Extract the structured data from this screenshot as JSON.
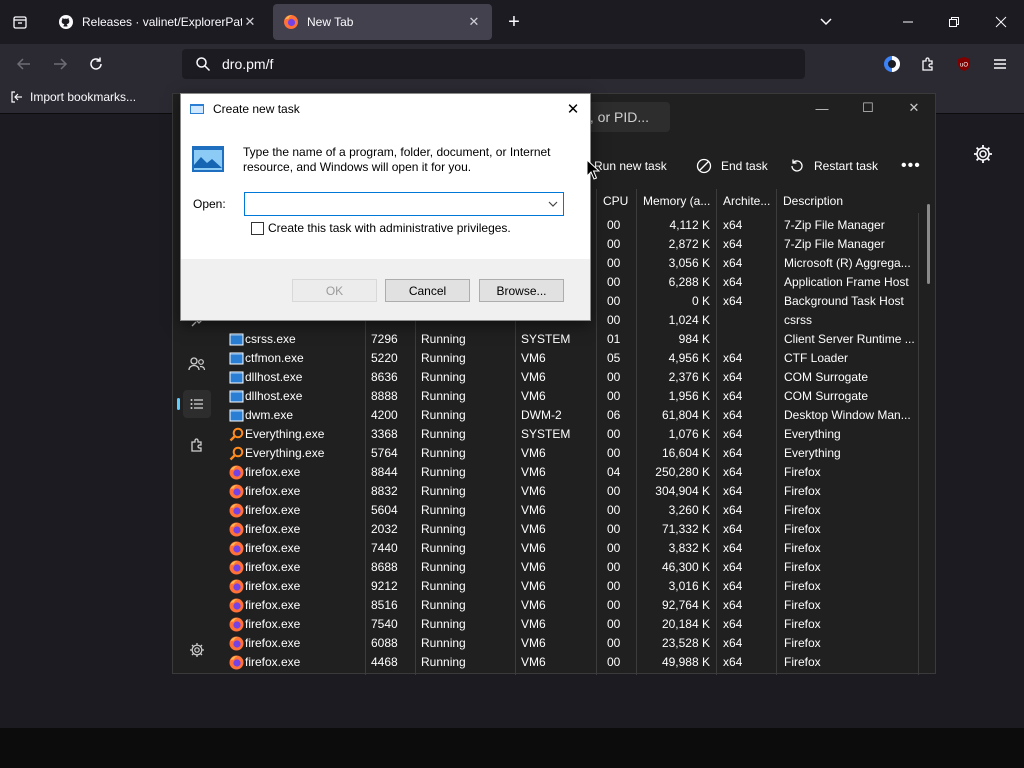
{
  "browser": {
    "tabs": [
      {
        "label": "Releases · valinet/ExplorerPatcher",
        "icon": "github-icon",
        "active": false
      },
      {
        "label": "New Tab",
        "icon": "firefox-icon",
        "active": true
      }
    ],
    "url": "dro.pm/f",
    "bookmark_import": "Import bookmarks..."
  },
  "taskmgr": {
    "search_placeholder": "r, or PID...",
    "toolbar": {
      "run_new_task": "Run new task",
      "end_task": "End task",
      "restart_task": "Restart task"
    },
    "columns": [
      "CPU",
      "Memory (a...",
      "Archite...",
      "Description"
    ],
    "rows": [
      {
        "name": "",
        "pid": "",
        "status": "",
        "user": "",
        "cpu": "00",
        "mem": "4,112 K",
        "arch": "x64",
        "desc": "7-Zip File Manager",
        "icon": ""
      },
      {
        "name": "",
        "pid": "",
        "status": "",
        "user": "",
        "cpu": "00",
        "mem": "2,872 K",
        "arch": "x64",
        "desc": "7-Zip File Manager",
        "icon": ""
      },
      {
        "name": "",
        "pid": "",
        "status": "",
        "user": "",
        "cpu": "00",
        "mem": "3,056 K",
        "arch": "x64",
        "desc": "Microsoft (R) Aggrega...",
        "icon": ""
      },
      {
        "name": "",
        "pid": "",
        "status": "",
        "user": "",
        "cpu": "00",
        "mem": "6,288 K",
        "arch": "x64",
        "desc": "Application Frame Host",
        "icon": ""
      },
      {
        "name": "",
        "pid": "",
        "status": "",
        "user": "",
        "cpu": "00",
        "mem": "0 K",
        "arch": "x64",
        "desc": "Background Task Host",
        "icon": ""
      },
      {
        "name": "",
        "pid": "",
        "status": "",
        "user": "",
        "cpu": "00",
        "mem": "1,024 K",
        "arch": "",
        "desc": "csrss",
        "icon": ""
      },
      {
        "name": "csrss.exe",
        "pid": "7296",
        "status": "Running",
        "user": "SYSTEM",
        "cpu": "01",
        "mem": "984 K",
        "arch": "",
        "desc": "Client Server Runtime ...",
        "icon": "window"
      },
      {
        "name": "ctfmon.exe",
        "pid": "5220",
        "status": "Running",
        "user": "VM6",
        "cpu": "05",
        "mem": "4,956 K",
        "arch": "x64",
        "desc": "CTF Loader",
        "icon": "window"
      },
      {
        "name": "dllhost.exe",
        "pid": "8636",
        "status": "Running",
        "user": "VM6",
        "cpu": "00",
        "mem": "2,376 K",
        "arch": "x64",
        "desc": "COM Surrogate",
        "icon": "window"
      },
      {
        "name": "dllhost.exe",
        "pid": "8888",
        "status": "Running",
        "user": "VM6",
        "cpu": "00",
        "mem": "1,956 K",
        "arch": "x64",
        "desc": "COM Surrogate",
        "icon": "window"
      },
      {
        "name": "dwm.exe",
        "pid": "4200",
        "status": "Running",
        "user": "DWM-2",
        "cpu": "06",
        "mem": "61,804 K",
        "arch": "x64",
        "desc": "Desktop Window Man...",
        "icon": "window"
      },
      {
        "name": "Everything.exe",
        "pid": "3368",
        "status": "Running",
        "user": "SYSTEM",
        "cpu": "00",
        "mem": "1,076 K",
        "arch": "x64",
        "desc": "Everything",
        "icon": "search"
      },
      {
        "name": "Everything.exe",
        "pid": "5764",
        "status": "Running",
        "user": "VM6",
        "cpu": "00",
        "mem": "16,604 K",
        "arch": "x64",
        "desc": "Everything",
        "icon": "search"
      },
      {
        "name": "firefox.exe",
        "pid": "8844",
        "status": "Running",
        "user": "VM6",
        "cpu": "04",
        "mem": "250,280 K",
        "arch": "x64",
        "desc": "Firefox",
        "icon": "firefox"
      },
      {
        "name": "firefox.exe",
        "pid": "8832",
        "status": "Running",
        "user": "VM6",
        "cpu": "00",
        "mem": "304,904 K",
        "arch": "x64",
        "desc": "Firefox",
        "icon": "firefox"
      },
      {
        "name": "firefox.exe",
        "pid": "5604",
        "status": "Running",
        "user": "VM6",
        "cpu": "00",
        "mem": "3,260 K",
        "arch": "x64",
        "desc": "Firefox",
        "icon": "firefox"
      },
      {
        "name": "firefox.exe",
        "pid": "2032",
        "status": "Running",
        "user": "VM6",
        "cpu": "00",
        "mem": "71,332 K",
        "arch": "x64",
        "desc": "Firefox",
        "icon": "firefox"
      },
      {
        "name": "firefox.exe",
        "pid": "7440",
        "status": "Running",
        "user": "VM6",
        "cpu": "00",
        "mem": "3,832 K",
        "arch": "x64",
        "desc": "Firefox",
        "icon": "firefox"
      },
      {
        "name": "firefox.exe",
        "pid": "8688",
        "status": "Running",
        "user": "VM6",
        "cpu": "00",
        "mem": "46,300 K",
        "arch": "x64",
        "desc": "Firefox",
        "icon": "firefox"
      },
      {
        "name": "firefox.exe",
        "pid": "9212",
        "status": "Running",
        "user": "VM6",
        "cpu": "00",
        "mem": "3,016 K",
        "arch": "x64",
        "desc": "Firefox",
        "icon": "firefox"
      },
      {
        "name": "firefox.exe",
        "pid": "8516",
        "status": "Running",
        "user": "VM6",
        "cpu": "00",
        "mem": "92,764 K",
        "arch": "x64",
        "desc": "Firefox",
        "icon": "firefox"
      },
      {
        "name": "firefox.exe",
        "pid": "7540",
        "status": "Running",
        "user": "VM6",
        "cpu": "00",
        "mem": "20,184 K",
        "arch": "x64",
        "desc": "Firefox",
        "icon": "firefox"
      },
      {
        "name": "firefox.exe",
        "pid": "6088",
        "status": "Running",
        "user": "VM6",
        "cpu": "00",
        "mem": "23,528 K",
        "arch": "x64",
        "desc": "Firefox",
        "icon": "firefox"
      },
      {
        "name": "firefox.exe",
        "pid": "4468",
        "status": "Running",
        "user": "VM6",
        "cpu": "00",
        "mem": "49,988 K",
        "arch": "x64",
        "desc": "Firefox",
        "icon": "firefox"
      }
    ]
  },
  "dialog": {
    "title": "Create new task",
    "description": "Type the name of a program, folder, document, or Internet resource, and Windows will open it for you.",
    "open_label": "Open:",
    "open_value": "",
    "admin_checkbox": "Create this task with administrative privileges.",
    "ok": "OK",
    "cancel": "Cancel",
    "browse": "Browse..."
  },
  "colors": {
    "accent": "#60cdff",
    "dialog_focus": "#0078d7",
    "firefox_orange": "#ff7139"
  }
}
